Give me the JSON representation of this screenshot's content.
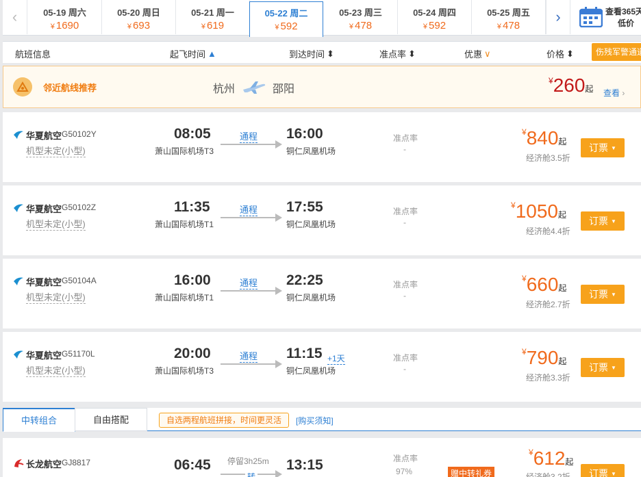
{
  "dates": [
    {
      "date": "05-19 周六",
      "price": "1690"
    },
    {
      "date": "05-20 周日",
      "price": "693"
    },
    {
      "date": "05-21 周一",
      "price": "619"
    },
    {
      "date": "05-22 周二",
      "price": "592"
    },
    {
      "date": "05-23 周三",
      "price": "478"
    },
    {
      "date": "05-24 周四",
      "price": "592"
    },
    {
      "date": "05-25 周五",
      "price": "478"
    }
  ],
  "currency": "¥",
  "calendar": {
    "line1": "查看365天",
    "line2": "低价"
  },
  "header": {
    "flight_info": "航班信息",
    "dep_time": "起飞时间",
    "arr_time": "到达时间",
    "ontime": "准点率",
    "discount": "优惠",
    "price": "价格",
    "warn_btn": "伤残军警通道"
  },
  "nearby": {
    "title": "邻近航线推荐",
    "from": "杭州",
    "to": "邵阳",
    "price": "260",
    "qi": "起",
    "link": "查看"
  },
  "flights": [
    {
      "airline": "华夏航空",
      "no": "G50102Y",
      "type": "机型未定(小型)",
      "dep": "08:05",
      "dep_ap": "萧山国际机场T3",
      "tag": "通程",
      "arr": "16:00",
      "plus": "",
      "arr_ap": "铜仁凤凰机场",
      "ontime_lbl": "准点率",
      "ontime": "-",
      "price": "840",
      "cabin": "经济舱3.5折"
    },
    {
      "airline": "华夏航空",
      "no": "G50102Z",
      "type": "机型未定(小型)",
      "dep": "11:35",
      "dep_ap": "萧山国际机场T1",
      "tag": "通程",
      "arr": "17:55",
      "plus": "",
      "arr_ap": "铜仁凤凰机场",
      "ontime_lbl": "准点率",
      "ontime": "-",
      "price": "1050",
      "cabin": "经济舱4.4折"
    },
    {
      "airline": "华夏航空",
      "no": "G50104A",
      "type": "机型未定(小型)",
      "dep": "16:00",
      "dep_ap": "萧山国际机场T1",
      "tag": "通程",
      "arr": "22:25",
      "plus": "",
      "arr_ap": "铜仁凤凰机场",
      "ontime_lbl": "准点率",
      "ontime": "-",
      "price": "660",
      "cabin": "经济舱2.7折"
    },
    {
      "airline": "华夏航空",
      "no": "G51170L",
      "type": "机型未定(小型)",
      "dep": "20:00",
      "dep_ap": "萧山国际机场T3",
      "tag": "通程",
      "arr": "11:15",
      "plus": "+1天",
      "arr_ap": "铜仁凤凰机场",
      "ontime_lbl": "准点率",
      "ontime": "-",
      "price": "790",
      "cabin": "经济舱3.3折"
    }
  ],
  "qi": "起",
  "book_label": "订票",
  "transfer": {
    "tab_active": "中转组合",
    "tab_other": "自由搭配",
    "hint": "自选两程航班拼接，时间更灵活",
    "link": "[购买须知]"
  },
  "transfer_flight": {
    "airline": "长龙航空",
    "no": "GJ8817",
    "stop": "停留3h25m",
    "tag": "转",
    "dep": "06:45",
    "arr": "13:15",
    "ontime_lbl": "准点率",
    "ontime": "97%",
    "promo": "赠中转礼券",
    "price": "612",
    "cabin": "经济舱3.2折"
  },
  "colors": {
    "accent": "#2d7fd3",
    "price": "#f06a1c",
    "book": "#f7a21b"
  }
}
